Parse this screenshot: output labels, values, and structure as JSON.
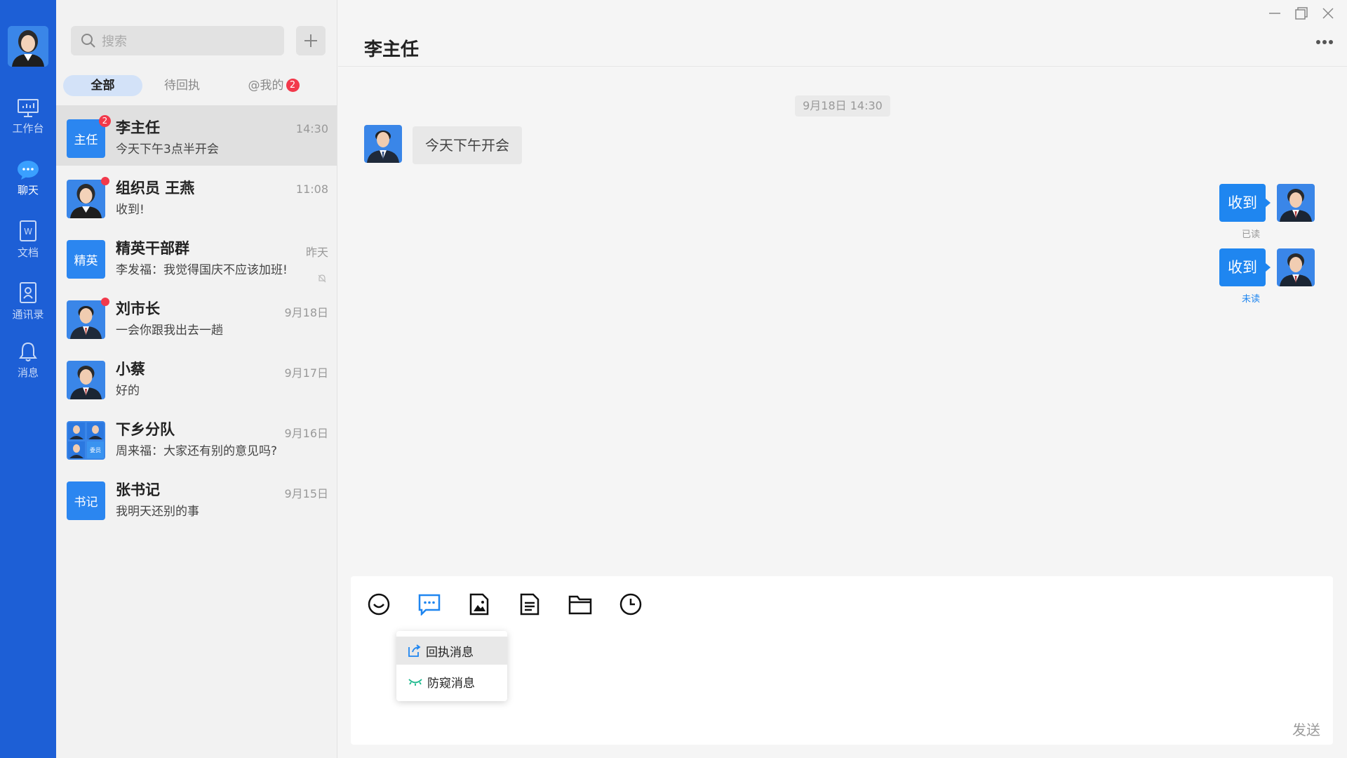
{
  "nav": {
    "items": [
      {
        "label": "工作台",
        "icon": "monitor-icon"
      },
      {
        "label": "聊天",
        "icon": "chat-bubble-icon",
        "active": true
      },
      {
        "label": "文档",
        "icon": "document-icon"
      },
      {
        "label": "通讯录",
        "icon": "contacts-icon"
      },
      {
        "label": "消息",
        "icon": "bell-icon"
      }
    ]
  },
  "search": {
    "placeholder": "搜索"
  },
  "tabs": [
    {
      "label": "全部",
      "active": true
    },
    {
      "label": "待回执"
    },
    {
      "label": "@我的",
      "count": "2"
    }
  ],
  "conversations": [
    {
      "name": "李主任",
      "time": "14:30",
      "preview": "今天下午3点半开会",
      "avatar_text": "主任",
      "badge": "2",
      "selected": true
    },
    {
      "name": "组织员 王燕",
      "time": "11:08",
      "preview": "收到!",
      "dot": true
    },
    {
      "name": "精英干部群",
      "time": "昨天",
      "preview": "李发福：我觉得国庆不应该加班!",
      "avatar_text": "精英",
      "muted": true
    },
    {
      "name": "刘市长",
      "time": "9月18日",
      "preview": "一会你跟我出去一趟",
      "dot": true
    },
    {
      "name": "小蔡",
      "time": "9月17日",
      "preview": "好的"
    },
    {
      "name": "下乡分队",
      "time": "9月16日",
      "preview": "周来福：大家还有别的意见吗?",
      "group_avatar_label": "委员"
    },
    {
      "name": "张书记",
      "time": "9月15日",
      "preview": "我明天还别的事",
      "avatar_text": "书记"
    }
  ],
  "chat": {
    "title": "李主任",
    "timestamp": "9月18日  14:30",
    "incoming": [
      {
        "text": "今天下午开会"
      }
    ],
    "outgoing": [
      {
        "text": "收到",
        "status": "已读"
      },
      {
        "text": "收到",
        "status": "未读"
      }
    ]
  },
  "composer": {
    "tools": [
      "emoji-icon",
      "message-type-icon",
      "image-icon",
      "file-icon",
      "folder-icon",
      "clock-icon"
    ],
    "menu": [
      {
        "label": "回执消息",
        "icon": "receipt-icon"
      },
      {
        "label": "防窥消息",
        "icon": "eye-closed-icon"
      }
    ],
    "send_label": "发送"
  },
  "colors": {
    "nav": "#1d5fd6",
    "accent": "#1f86f0",
    "badge": "#f2394b",
    "read_status": "#999999",
    "unread_status": "#1f86f0"
  }
}
